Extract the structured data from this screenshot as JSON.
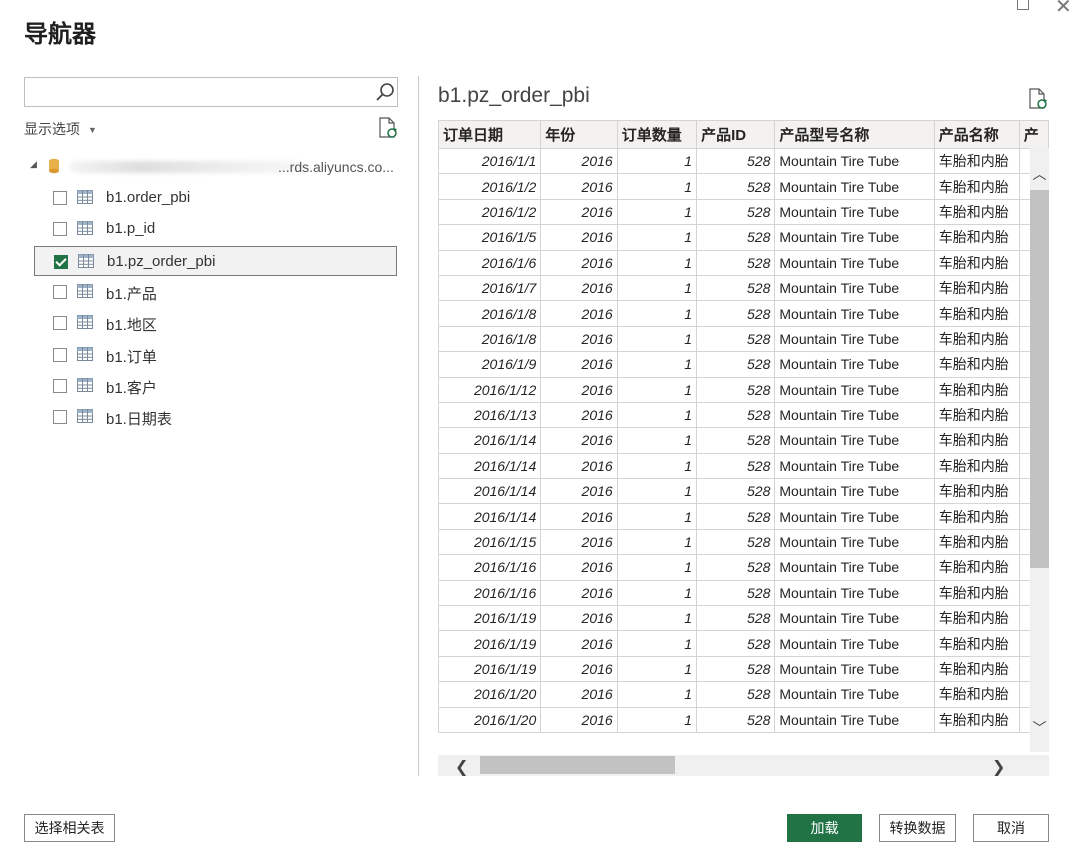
{
  "window": {
    "title": "导航器"
  },
  "left_panel": {
    "search": {
      "value": "",
      "placeholder": ""
    },
    "display_options": "显示选项",
    "server": {
      "name_visible": "...rds.aliyuncs.co..."
    },
    "items": [
      {
        "label": "b1.order_pbi",
        "checked": false
      },
      {
        "label": "b1.p_id",
        "checked": false
      },
      {
        "label": "b1.pz_order_pbi",
        "checked": true
      },
      {
        "label": "b1.产品",
        "checked": false
      },
      {
        "label": "b1.地区",
        "checked": false
      },
      {
        "label": "b1.订单",
        "checked": false
      },
      {
        "label": "b1.客户",
        "checked": false
      },
      {
        "label": "b1.日期表",
        "checked": false
      }
    ]
  },
  "preview": {
    "title": "b1.pz_order_pbi",
    "columns": [
      "订单日期",
      "年份",
      "订单数量",
      "产品ID",
      "产品型号名称",
      "产品名称",
      "产"
    ],
    "rows": [
      [
        "2016/1/1",
        "2016",
        "1",
        "528",
        "Mountain Tire Tube",
        "车胎和内胎"
      ],
      [
        "2016/1/2",
        "2016",
        "1",
        "528",
        "Mountain Tire Tube",
        "车胎和内胎"
      ],
      [
        "2016/1/2",
        "2016",
        "1",
        "528",
        "Mountain Tire Tube",
        "车胎和内胎"
      ],
      [
        "2016/1/5",
        "2016",
        "1",
        "528",
        "Mountain Tire Tube",
        "车胎和内胎"
      ],
      [
        "2016/1/6",
        "2016",
        "1",
        "528",
        "Mountain Tire Tube",
        "车胎和内胎"
      ],
      [
        "2016/1/7",
        "2016",
        "1",
        "528",
        "Mountain Tire Tube",
        "车胎和内胎"
      ],
      [
        "2016/1/8",
        "2016",
        "1",
        "528",
        "Mountain Tire Tube",
        "车胎和内胎"
      ],
      [
        "2016/1/8",
        "2016",
        "1",
        "528",
        "Mountain Tire Tube",
        "车胎和内胎"
      ],
      [
        "2016/1/9",
        "2016",
        "1",
        "528",
        "Mountain Tire Tube",
        "车胎和内胎"
      ],
      [
        "2016/1/12",
        "2016",
        "1",
        "528",
        "Mountain Tire Tube",
        "车胎和内胎"
      ],
      [
        "2016/1/13",
        "2016",
        "1",
        "528",
        "Mountain Tire Tube",
        "车胎和内胎"
      ],
      [
        "2016/1/14",
        "2016",
        "1",
        "528",
        "Mountain Tire Tube",
        "车胎和内胎"
      ],
      [
        "2016/1/14",
        "2016",
        "1",
        "528",
        "Mountain Tire Tube",
        "车胎和内胎"
      ],
      [
        "2016/1/14",
        "2016",
        "1",
        "528",
        "Mountain Tire Tube",
        "车胎和内胎"
      ],
      [
        "2016/1/14",
        "2016",
        "1",
        "528",
        "Mountain Tire Tube",
        "车胎和内胎"
      ],
      [
        "2016/1/15",
        "2016",
        "1",
        "528",
        "Mountain Tire Tube",
        "车胎和内胎"
      ],
      [
        "2016/1/16",
        "2016",
        "1",
        "528",
        "Mountain Tire Tube",
        "车胎和内胎"
      ],
      [
        "2016/1/16",
        "2016",
        "1",
        "528",
        "Mountain Tire Tube",
        "车胎和内胎"
      ],
      [
        "2016/1/19",
        "2016",
        "1",
        "528",
        "Mountain Tire Tube",
        "车胎和内胎"
      ],
      [
        "2016/1/19",
        "2016",
        "1",
        "528",
        "Mountain Tire Tube",
        "车胎和内胎"
      ],
      [
        "2016/1/19",
        "2016",
        "1",
        "528",
        "Mountain Tire Tube",
        "车胎和内胎"
      ],
      [
        "2016/1/20",
        "2016",
        "1",
        "528",
        "Mountain Tire Tube",
        "车胎和内胎"
      ],
      [
        "2016/1/20",
        "2016",
        "1",
        "528",
        "Mountain Tire Tube",
        "车胎和内胎"
      ]
    ]
  },
  "footer": {
    "select_related": "选择相关表",
    "load": "加载",
    "transform": "转换数据",
    "cancel": "取消"
  },
  "icons": {
    "search": "search-icon",
    "refresh_doc": "document-refresh-icon",
    "database": "database-icon",
    "table": "table-icon"
  },
  "colors": {
    "accent": "#217346",
    "header_bg": "#f3f2f1",
    "selected_border": "#7a7a7a"
  }
}
